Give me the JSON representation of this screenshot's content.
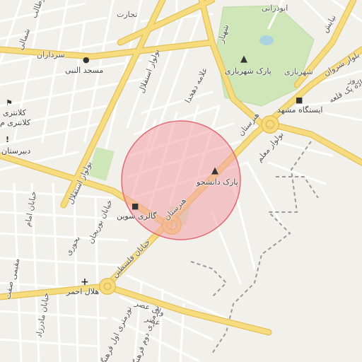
{
  "map": {
    "labels": {
      "tejarat": "تجارت",
      "abutaleb": "ابوطالب",
      "shomali": "شمالی",
      "sardaran": "سرداران",
      "masjed_nabi": "مسجد النبی",
      "kalantari": "کلانتری",
      "kalantari_m": "کلانتری م",
      "dabirestan": "دبیرستان",
      "bolvar_esteghlal_top": "بولوار استقلال",
      "allameh_dehkhoda": "علامه دهخدا",
      "shahnaz": "شهناز",
      "park_shahr_bazi": "پارک شهربازی",
      "shahr_bazi": "شهربازی",
      "abuzar": "ابوذرانی",
      "nayayesh": "نیایش",
      "bolvar_shervan": "بلوار شروان",
      "ruz": "روز",
      "jadeh_qale": "جاده پک قلعه",
      "istgah_mashhad": "ایستگاه مشهد",
      "honarestan_top": "هنرستان",
      "bolvar_moallem": "بولوار معلم",
      "park_daneshju": "پارک دانشجو",
      "bolvar_esteghlal_left": "بولوار استقلال",
      "khiaban_imam": "خیابان امام",
      "bourian": "خیابان بوریجان",
      "bohuri": "بحوری",
      "galeri_savin": "گالری سوین",
      "honarestan_mid": "هنرستان",
      "felestin": "خیابان فلسطین",
      "hilal_ahmar": "هلال احمر",
      "khiaban_madar": "خیابان مادرزاد",
      "sefat": "صفت",
      "vali_asr": "ولی عصر",
      "sevom_farhang": "نورمتری اول فرهنگ",
      "doyom_farhang": "نورمتری دوم فرهنگ",
      "moghimi": "مقیمی",
      "asr": "عصر"
    },
    "colors": {
      "background": "#f2f0eb",
      "park": "#cfe6b8",
      "major_road": "#f6dc7e",
      "major_road_stroke": "#e2c15a",
      "minor_road": "#ffffff",
      "circle_fill": "#f4a0a6",
      "circle_stroke": "#e06b75"
    },
    "icons": {
      "tree": "tree-icon",
      "mosque": "mosque-icon",
      "police": "police-icon",
      "school": "school-icon",
      "bus": "bus-icon",
      "shop": "shop-icon",
      "hospital": "hospital-icon"
    }
  }
}
